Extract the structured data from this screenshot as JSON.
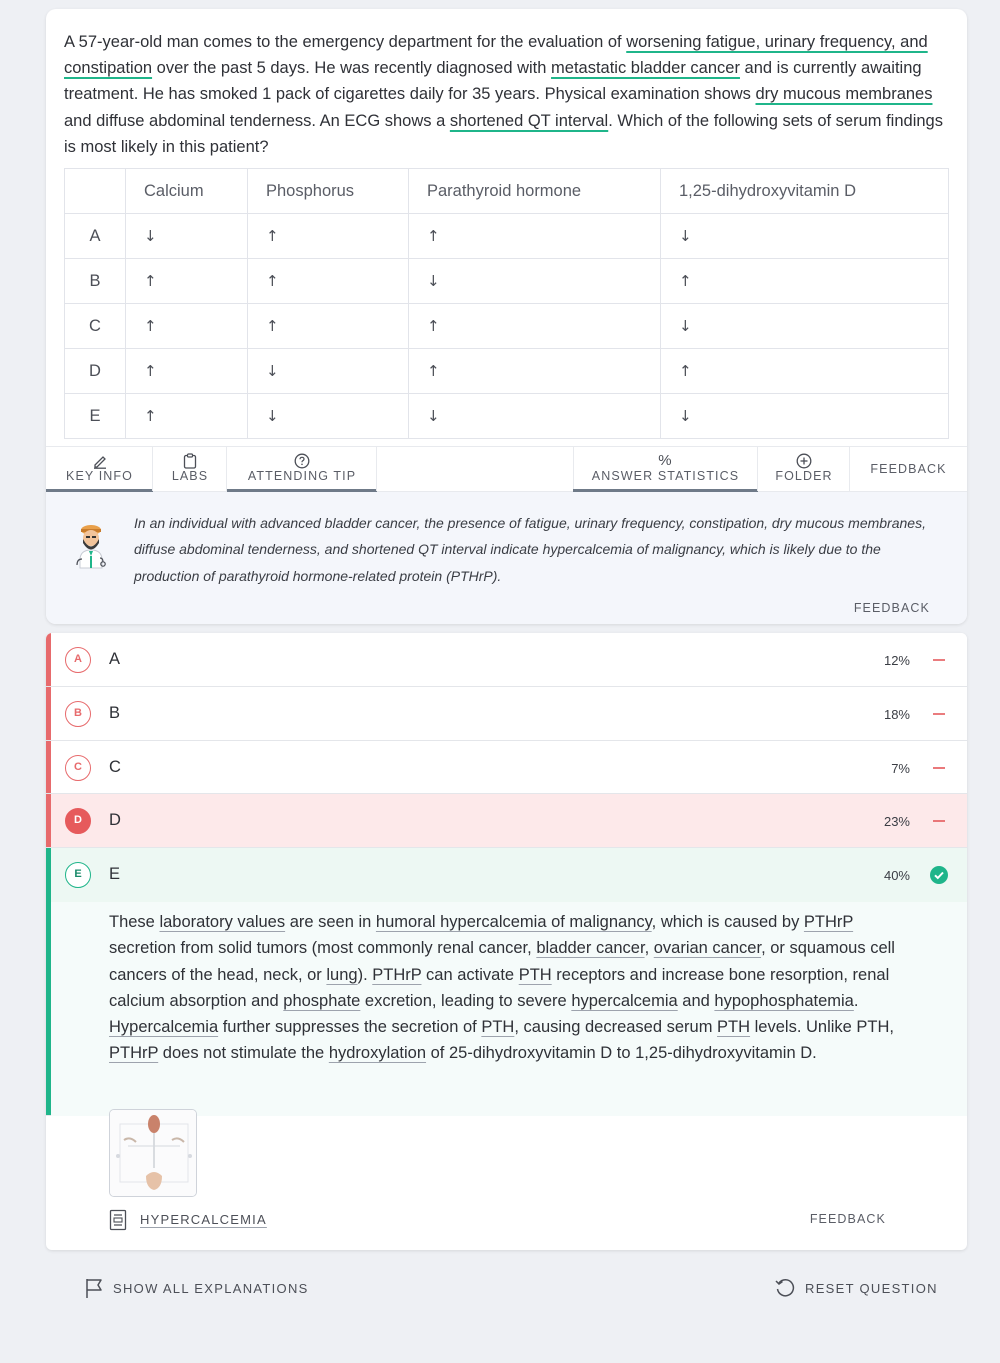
{
  "question": {
    "stem": [
      {
        "t": "A 57-year-old man comes to the emergency department for the evaluation of "
      },
      {
        "t": "worsening fatigue, urinary frequency, and constipation",
        "hl": true
      },
      {
        "t": " over the past 5 days. He was recently diagnosed with "
      },
      {
        "t": "metastatic bladder cancer",
        "hl": true
      },
      {
        "t": " and is currently awaiting treatment. He has smoked 1 pack of cigarettes daily for 35 years. Physical examination shows "
      },
      {
        "t": "dry mucous membranes",
        "hl": true
      },
      {
        "t": " and diffuse abdominal tenderness. An ECG shows a "
      },
      {
        "t": "shortened QT interval",
        "hl": true
      },
      {
        "t": ". Which of the following sets of serum findings is most likely in this patient?"
      }
    ]
  },
  "lab_table": {
    "headers": [
      "",
      "Calcium",
      "Phosphorus",
      "Parathyroid hormone",
      "1,25-dihydroxyvitamin D"
    ],
    "rows": [
      [
        "A",
        "↓",
        "↑",
        "↑",
        "↓"
      ],
      [
        "B",
        "↑",
        "↑",
        "↓",
        "↑"
      ],
      [
        "C",
        "↑",
        "↑",
        "↑",
        "↓"
      ],
      [
        "D",
        "↑",
        "↓",
        "↑",
        "↑"
      ],
      [
        "E",
        "↑",
        "↓",
        "↓",
        "↓"
      ]
    ]
  },
  "tabs": {
    "key_info": "KEY INFO",
    "labs": "LABS",
    "attending_tip": "ATTENDING TIP",
    "answer_statistics": "ANSWER STATISTICS",
    "folder": "FOLDER",
    "feedback": "FEEDBACK",
    "active": [
      "key_info",
      "attending_tip",
      "answer_statistics"
    ]
  },
  "attending_tip": {
    "text": "In an individual with advanced bladder cancer, the presence of fatigue, urinary frequency, constipation, dry mucous membranes, diffuse abdominal tenderness, and shortened QT interval indicate hypercalcemia of malignancy, which is likely due to the production of parathyroid hormone-related protein (PTHrP).",
    "feedback": "FEEDBACK"
  },
  "answers": [
    {
      "letter": "A",
      "text": "A",
      "percent": "12%",
      "status": "wrong"
    },
    {
      "letter": "B",
      "text": "B",
      "percent": "18%",
      "status": "wrong"
    },
    {
      "letter": "C",
      "text": "C",
      "percent": "7%",
      "status": "wrong"
    },
    {
      "letter": "D",
      "text": "D",
      "percent": "23%",
      "status": "selected_wrong"
    },
    {
      "letter": "E",
      "text": "E",
      "percent": "40%",
      "status": "correct"
    }
  ],
  "explanation": {
    "text": [
      {
        "t": "These "
      },
      {
        "t": "laboratory values",
        "l": true
      },
      {
        "t": " are seen in "
      },
      {
        "t": "humoral hypercalcemia of malignancy",
        "l": true
      },
      {
        "t": ", which is caused by "
      },
      {
        "t": "PTHrP",
        "l": true
      },
      {
        "t": " secretion from solid tumors (most commonly renal cancer, "
      },
      {
        "t": "bladder cancer",
        "l": true
      },
      {
        "t": ", "
      },
      {
        "t": "ovarian cancer",
        "l": true
      },
      {
        "t": ", or squamous cell cancers of the head, neck, or "
      },
      {
        "t": "lung",
        "l": true
      },
      {
        "t": "). "
      },
      {
        "t": "PTHrP",
        "l": true
      },
      {
        "t": " can activate "
      },
      {
        "t": "PTH",
        "l": true
      },
      {
        "t": " receptors and increase bone resorption, renal calcium absorption and "
      },
      {
        "t": "phosphate",
        "l": true
      },
      {
        "t": " excretion, leading to severe "
      },
      {
        "t": "hypercalcemia",
        "l": true
      },
      {
        "t": " and "
      },
      {
        "t": "hypophosphatemia",
        "l": true
      },
      {
        "t": ". "
      },
      {
        "t": "Hypercalcemia",
        "l": true
      },
      {
        "t": " further suppresses the secretion of "
      },
      {
        "t": "PTH",
        "l": true
      },
      {
        "t": ", causing decreased serum "
      },
      {
        "t": "PTH",
        "l": true
      },
      {
        "t": " levels. Unlike PTH, "
      },
      {
        "t": "PTHrP",
        "l": true
      },
      {
        "t": " does not stimulate the "
      },
      {
        "t": "hydroxylation",
        "l": true
      },
      {
        "t": " of 25-dihydroxyvitamin D to 1,25-dihydroxyvitamin D."
      }
    ],
    "article_link": "HYPERCALCEMIA",
    "feedback": "FEEDBACK"
  },
  "footer": {
    "show_all": "SHOW ALL EXPLANATIONS",
    "reset": "RESET QUESTION"
  },
  "colors": {
    "highlight": "#1fb58a",
    "wrong": "#e76a6c",
    "selected_wrong_bg": "#fde9ea",
    "selected_wrong_circle": "#e65a5c",
    "correct": "#1fb58a",
    "correct_bg": "#edf8f3",
    "explanation_bg": "#f5fbfa"
  }
}
